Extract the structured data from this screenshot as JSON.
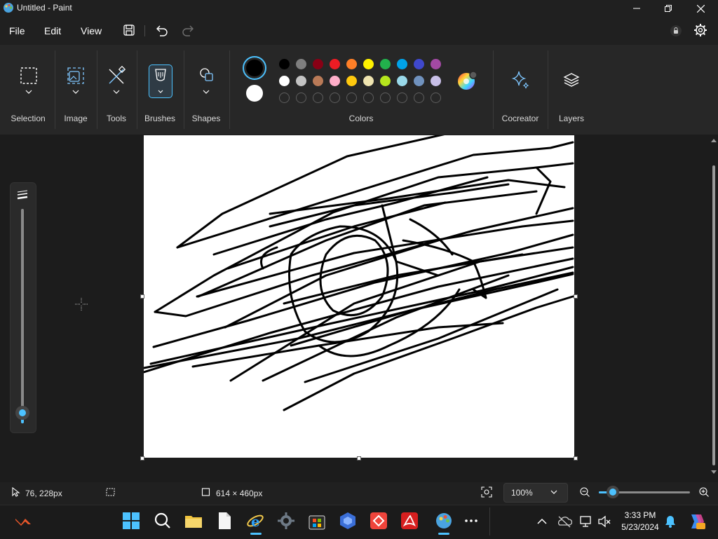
{
  "window": {
    "title": "Untitled - Paint"
  },
  "menu": {
    "file": "File",
    "edit": "Edit",
    "view": "View"
  },
  "ribbon": {
    "groups": {
      "selection": "Selection",
      "image": "Image",
      "tools": "Tools",
      "brushes": "Brushes",
      "shapes": "Shapes",
      "colors": "Colors",
      "cocreator": "Cocreator",
      "layers": "Layers"
    },
    "primary_color": "#000000",
    "secondary_color": "#ffffff",
    "palette_row1": [
      "#000000",
      "#7f7f7f",
      "#880015",
      "#ed1c24",
      "#ff7f27",
      "#fff200",
      "#22b14c",
      "#00a2e8",
      "#3f48cc",
      "#a349a4"
    ],
    "palette_row2": [
      "#ffffff",
      "#c3c3c3",
      "#b97a57",
      "#ffaec9",
      "#ffc90e",
      "#efe4b0",
      "#b5e61d",
      "#99d9ea",
      "#7092be",
      "#c8bfe7"
    ],
    "accent": "#4cc2ff"
  },
  "statusbar": {
    "cursor_position": "76, 228px",
    "canvas_size": "614 × 460px",
    "zoom": "100%",
    "zoom_slider_fraction": 0.15,
    "brush_size_fraction": 0.05
  },
  "taskbar": {
    "time": "3:33 PM",
    "date": "5/23/2024"
  }
}
